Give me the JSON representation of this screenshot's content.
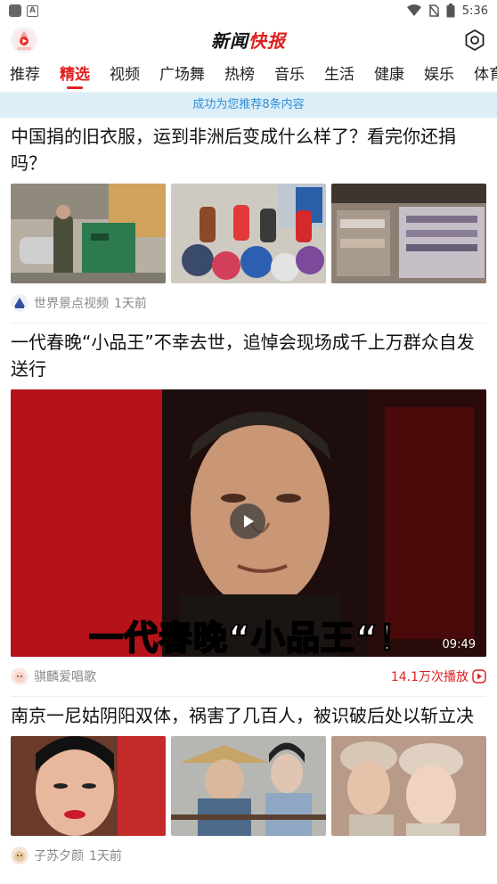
{
  "status_bar": {
    "time": "5:36"
  },
  "app": {
    "title_left": "新闻",
    "title_accent": "快报"
  },
  "tabs": [
    "推荐",
    "精选",
    "视频",
    "广场舞",
    "热榜",
    "音乐",
    "生活",
    "健康",
    "娱乐",
    "体育"
  ],
  "active_tab_index": 1,
  "banner": "成功为您推荐8条内容",
  "articles": [
    {
      "title": "中国捐的旧衣服，运到非洲后变成什么样了？看完你还捐吗？",
      "source": "世界景点视频",
      "time": "1天前"
    },
    {
      "title": "一代春晚“小品王”不幸去世，追悼会现场成千上万群众自发送行",
      "source": "骐麟爱唱歌",
      "duration": "09:49",
      "plays": "14.1万次播放",
      "video_caption_prefix": "一代春晚“",
      "video_caption_name": "小品王",
      "video_caption_suffix": "“！"
    },
    {
      "title": "南京一尼姑阴阳双体，祸害了几百人，被识破后处以斩立决",
      "source": "子苏夕颜",
      "time": "1天前"
    }
  ],
  "icons": {
    "logo": "app-logo-icon",
    "settings": "settings-icon",
    "play": "play-icon",
    "wifi": "wifi-icon",
    "battery": "battery-icon"
  },
  "colors": {
    "accent": "#e02020",
    "banner_bg": "#dceef8",
    "banner_text": "#2f8fd8"
  }
}
